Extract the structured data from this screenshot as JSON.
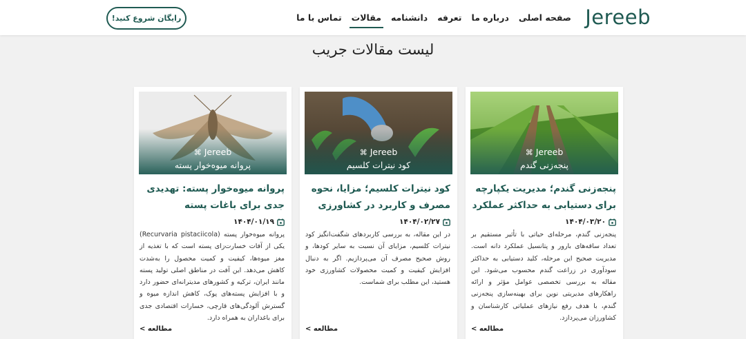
{
  "header": {
    "logo": "Jereeb",
    "nav": [
      {
        "label": "صفحه اصلی",
        "active": false
      },
      {
        "label": "درباره ما",
        "active": false
      },
      {
        "label": "تعرفه",
        "active": false
      },
      {
        "label": "دانشنامه",
        "active": false
      },
      {
        "label": "مقالات",
        "active": true
      },
      {
        "label": "تماس با ما",
        "active": false
      }
    ],
    "cta": "رایگان شروع کنید!"
  },
  "page_title": "لیست مقالات جریب",
  "brand_overlay": "Jereeb",
  "read_more": "مطالعه >",
  "colors": {
    "accent": "#1f5a52",
    "background": "#f1f1f1",
    "card": "#ffffff"
  },
  "articles": [
    {
      "image_caption": "پنجه‌زنی گندم",
      "title": "پنجه‌زنی گندم؛ مدیریت یکپارچه برای دستیابی به حداکثر عملکرد",
      "date": "۱۴۰۴/۰۳/۲۰",
      "excerpt": "پنجه‌زنی گندم، مرحله‌ای حیاتی با تأثیر مستقیم بر تعداد ساقه‌های بارور و پتانسیل عملکرد دانه است. مدیریت صحیح این مرحله، کلید دستیابی به حداکثر سودآوری در زراعت گندم محسوب می‌شود. این مقاله به بررسی تخصصی عوامل مؤثر و ارائه راهکارهای مدیریتی نوین برای بهینه‌سازی پنجه‌زنی گندم، با هدف رفع نیازهای عملیاتی کارشناسان و کشاورزان می‌پردازد."
    },
    {
      "image_caption": "کود نیترات کلسیم",
      "title": "کود نیترات کلسیم؛ مزایا، نحوه مصرف و کاربرد در کشاورزی",
      "date": "۱۴۰۴/۰۲/۲۷",
      "excerpt": "در این مقاله، به بررسی کاربردهای شگفت‌انگیز کود نیترات کلسیم، مزایای آن نسبت به سایر کودها، و روش صحیح مصرف آن می‌پردازیم. اگر به دنبال افزایش کیفیت و کمیت محصولات کشاورزی خود هستید، این مطلب برای شماست."
    },
    {
      "image_caption": "پروانه میوه‌خوار پسته",
      "title": "پروانه میوه‌خوار پسته: تهدیدی جدی برای باغات پسته",
      "date": "۱۴۰۴/۰۱/۱۹",
      "excerpt": "پروانه میوه‌خوار پسته (Recurvaria pistaciicola) یکی از آفات خسارت‌زای پسته است که با تغذیه از مغز میوه‌ها، کیفیت و کمیت محصول را به‌شدت کاهش می‌دهد. این آفت در مناطق اصلی تولید پسته مانند ایران، ترکیه و کشورهای مدیترانه‌ای حضور دارد و با افزایش پسته‌های پوک، کاهش اندازه میوه و گسترش آلودگی‌های قارچی، خسارات اقتصادی جدی برای باغداران به همراه دارد."
    }
  ]
}
